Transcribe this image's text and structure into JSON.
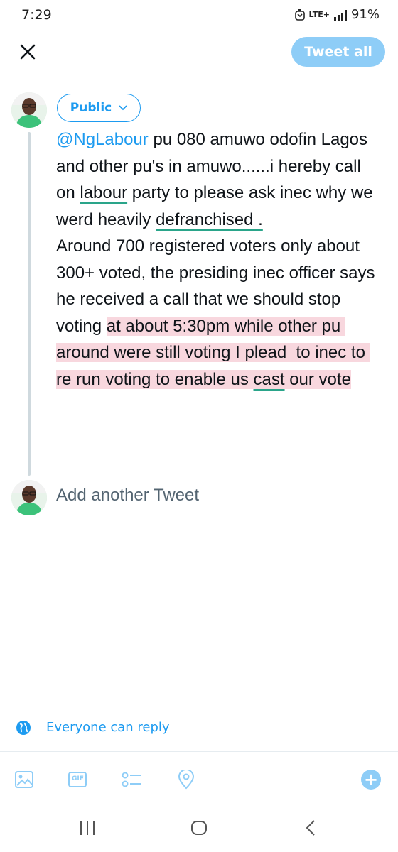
{
  "status": {
    "time": "7:29",
    "network": "LTE+",
    "battery": "91%"
  },
  "header": {
    "tweet_all_label": "Tweet all"
  },
  "composer": {
    "audience_label": "Public",
    "text_segments": [
      {
        "text": "@NgLabour",
        "style": "mention"
      },
      {
        "text": " pu 080 amuwo odofin Lagos and other pu's in amuwo......i hereby call on ",
        "style": "plain"
      },
      {
        "text": "labour",
        "style": "underline"
      },
      {
        "text": " party to please ask inec why we werd heavily ",
        "style": "plain"
      },
      {
        "text": "defranchised .",
        "style": "underline"
      },
      {
        "text": "\nAround 700 registered voters only about 300+ voted, the presiding inec officer says he received a call that we should stop voting ",
        "style": "plain"
      },
      {
        "text": "at about 5:30pm while other pu around were still voting I plead  to inec to re run voting to enable us ",
        "style": "highlight"
      },
      {
        "text": "cast",
        "style": "highlight-underline"
      },
      {
        "text": " our vote",
        "style": "highlight"
      }
    ],
    "add_another_placeholder": "Add another Tweet"
  },
  "reply_settings": {
    "label": "Everyone can reply"
  },
  "toolbar": {
    "icons": [
      "image-icon",
      "gif-icon",
      "poll-icon",
      "location-icon"
    ],
    "gif_label": "GIF",
    "add_icon": "+"
  },
  "colors": {
    "accent": "#1d9bf0",
    "accent_disabled": "#8ecdf7",
    "highlight": "#f8d7de",
    "spell_underline": "#2aa58a"
  }
}
